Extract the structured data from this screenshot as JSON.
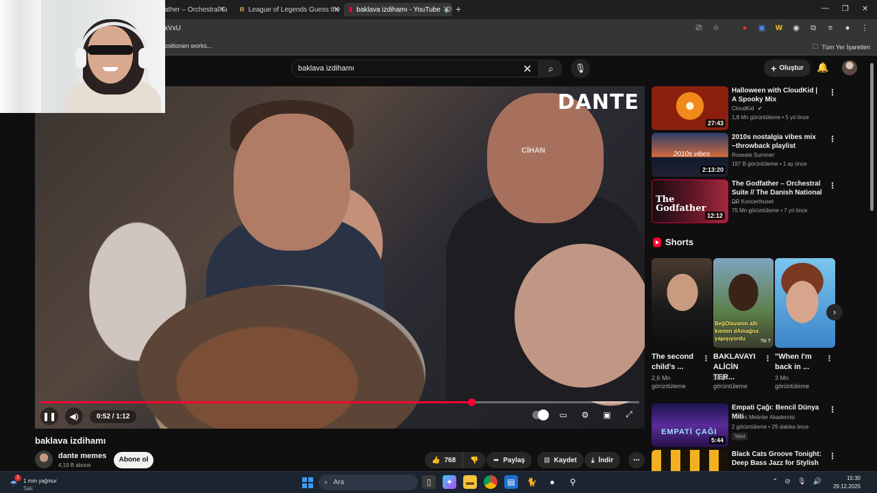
{
  "browser": {
    "tabs": [
      {
        "title": "ather – Orchestral Sui",
        "favicon": "youtube-icon"
      },
      {
        "title": "League of Legends Guess the R",
        "favicon": "r-letter-icon"
      },
      {
        "title": "baklava izdihamı - YouTube",
        "favicon": "youtube-icon",
        "active": true
      }
    ],
    "url_fragment": "xVxU",
    "bookmark_visible": "ositionen works...",
    "bookmarks_folder": "Tüm Yer İşaretleri"
  },
  "youtube": {
    "search_value": "baklava izdihamı",
    "create_label": "Oluştur"
  },
  "player": {
    "watermark": "DANTE",
    "channel_watermark": "CİHAN",
    "time": "0:52 / 1:12",
    "progress": 0.72
  },
  "video": {
    "title": "baklava izdihamı",
    "channel": "dante memes",
    "subscribers": "4,19 B abone",
    "subscribe_label": "Abone ol",
    "likes": "768",
    "share_label": "Paylaş",
    "save_label": "Kaydet",
    "download_label": "İndir"
  },
  "recommendations": [
    {
      "title": "Halloween with CloudKid | A Spooky Mix",
      "channel": "CloudKid",
      "verified": true,
      "meta": "1,8 Mn görüntüleme • 5 yıl önce",
      "duration": "27:43"
    },
    {
      "title": "2010s nostalgia vibes mix ~throwback playlist",
      "channel": "Roseate Summer",
      "meta": "197 B görüntüleme • 1 ay önce",
      "duration": "2:13:20",
      "thumb_text": "2010s vibes"
    },
    {
      "title": "The Godfather – Orchestral Suite // The Danish National ...",
      "channel": "DR Koncerthuset",
      "meta": "75 Mn görüntüleme • 7 yıl önce",
      "duration": "12:12",
      "thumb_text": "The Godfather"
    },
    {
      "title": "Empati Çağı: Bencil Dünya Miti",
      "channel": "Resmi Metinler Akademisi",
      "meta": "2 görüntüleme • 29 dakika önce",
      "duration": "5:44",
      "badge": "Yeni",
      "thumb_text": "EMPATİ ÇAĞI"
    },
    {
      "title": "Black Cats Groove Tonight: Deep Bass Jazz for Stylish ...",
      "channel": "",
      "meta": ""
    }
  ],
  "shorts": {
    "heading": "Shorts",
    "items": [
      {
        "title": "The second child's ...",
        "views": "2,6 Mn görüntüleme"
      },
      {
        "title": "BAKLAVAYI ALİCİN TER...",
        "views": "38 B görüntüleme",
        "overlay": "BeğOlavanın altı kısmın dAmağna yapışıyordu",
        "thumb_badge": "Tik T"
      },
      {
        "title": "\"When I'm back in ...",
        "views": "3 Mn görüntüleme"
      }
    ]
  },
  "taskbar": {
    "weather_line1": "1 mm yağmur",
    "weather_line2": "Salı",
    "weather_badge": "1",
    "search_placeholder": "Ara",
    "time": "15:30",
    "date": "29.12.2025"
  },
  "colors": {
    "accent_red": "#ff0033",
    "page_bg": "#0f0f0f",
    "chrome_bg": "#353535"
  }
}
